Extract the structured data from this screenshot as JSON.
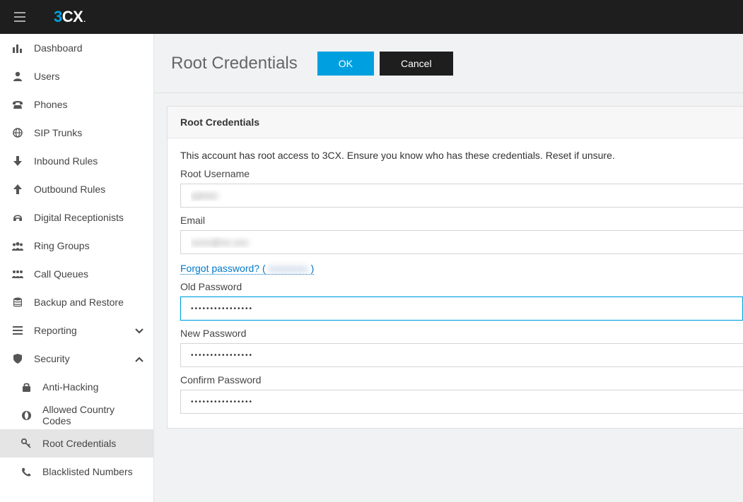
{
  "header": {
    "logo_part1": "3",
    "logo_part2": "CX",
    "logo_dot": "."
  },
  "sidebar": {
    "items": [
      {
        "label": "Dashboard",
        "icon": "bar-chart-icon"
      },
      {
        "label": "Users",
        "icon": "user-icon"
      },
      {
        "label": "Phones",
        "icon": "phone-old-icon"
      },
      {
        "label": "SIP Trunks",
        "icon": "globe-icon"
      },
      {
        "label": "Inbound Rules",
        "icon": "arrow-down-icon"
      },
      {
        "label": "Outbound Rules",
        "icon": "arrow-up-icon"
      },
      {
        "label": "Digital Receptionists",
        "icon": "headset-icon"
      },
      {
        "label": "Ring Groups",
        "icon": "users-group-icon"
      },
      {
        "label": "Call Queues",
        "icon": "queue-icon"
      },
      {
        "label": "Backup and Restore",
        "icon": "database-icon"
      },
      {
        "label": "Reporting",
        "icon": "list-icon",
        "chevron": "down"
      },
      {
        "label": "Security",
        "icon": "shield-icon",
        "chevron": "up"
      }
    ],
    "security_sub": [
      {
        "label": "Anti-Hacking",
        "icon": "lock-icon"
      },
      {
        "label": "Allowed Country Codes",
        "icon": "globe-thick-icon"
      },
      {
        "label": "Root Credentials",
        "icon": "key-icon",
        "active": true
      },
      {
        "label": "Blacklisted Numbers",
        "icon": "phone-icon"
      }
    ]
  },
  "page": {
    "title": "Root Credentials",
    "ok_label": "OK",
    "cancel_label": "Cancel"
  },
  "panel": {
    "heading": "Root Credentials",
    "description": "This account has root access to 3CX. Ensure you know who has these credentials. Reset if unsure.",
    "root_username_label": "Root Username",
    "root_username_value": "admin",
    "email_label": "Email",
    "email_value": "xxxx@xx.xxx",
    "forgot_text": "Forgot password? (",
    "forgot_close": ")",
    "forgot_hidden": "xxxxxxxx",
    "old_pw_label": "Old Password",
    "old_pw_value": "••••••••••••••••",
    "new_pw_label": "New Password",
    "new_pw_value": "••••••••••••••••",
    "confirm_pw_label": "Confirm Password",
    "confirm_pw_value": "••••••••••••••••"
  }
}
